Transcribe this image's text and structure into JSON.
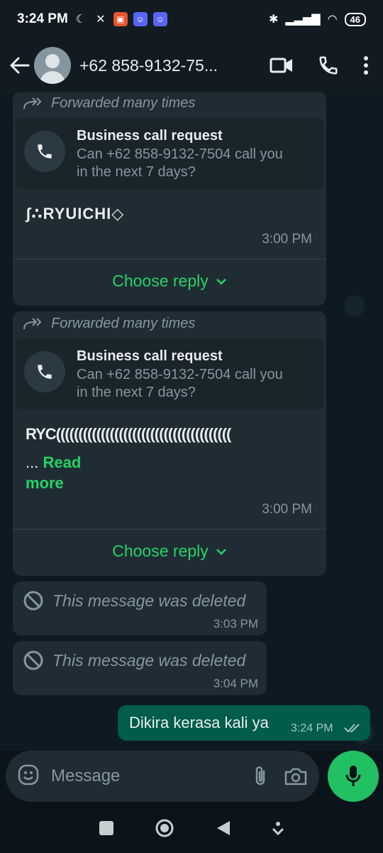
{
  "status_bar": {
    "time": "3:24 PM",
    "battery": "46",
    "colors": {
      "orange_app": "#e8552c",
      "discord": "#5865f2"
    }
  },
  "header": {
    "contact_name": "+62 858-9132-75...",
    "icons": [
      "back-arrow-icon",
      "avatar",
      "video-call-icon",
      "voice-call-icon",
      "more-options-icon"
    ]
  },
  "messages": [
    {
      "type": "call_request",
      "forward_label": "Forwarded many times",
      "card_title": "Business call request",
      "card_line1": "Can +62 858-9132-7504 call you",
      "card_line2": "in the next 7 days?",
      "body": "ʃ∴RYUICHI◇",
      "time": "3:00 PM",
      "reply_label": "Choose reply"
    },
    {
      "type": "call_request",
      "forward_label": "Forwarded many times",
      "card_title": "Business call request",
      "card_line1": "Can +62 858-9132-7504 call you",
      "card_line2": "in the next 7 days?",
      "body": "RYC(((((((((((((((((((((((((((((((((((((((",
      "ellipsis": "...",
      "read_more_1": "Read",
      "read_more_2": "more",
      "time": "3:00 PM",
      "reply_label": "Choose reply"
    },
    {
      "type": "deleted",
      "text": "This message was deleted",
      "time": "3:03 PM"
    },
    {
      "type": "deleted",
      "text": "This message was deleted",
      "time": "3:04 PM"
    },
    {
      "type": "outgoing",
      "text": "Dikira kerasa kali ya",
      "time": "3:24 PM",
      "status": "delivered"
    }
  ],
  "composer": {
    "placeholder": "Message",
    "icons": [
      "emoji-icon",
      "attach-icon",
      "camera-icon",
      "mic-icon"
    ]
  },
  "theme": {
    "accent_green": "#25d366",
    "mic_green": "#21c063",
    "bubble_in": "#202c33",
    "bubble_out": "#005c4b"
  }
}
